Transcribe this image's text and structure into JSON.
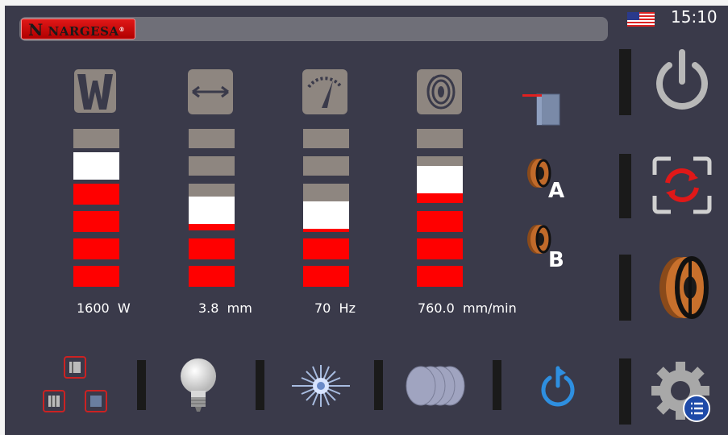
{
  "header": {
    "brand": "NARGESA",
    "brand_initial": "N",
    "registered": "®",
    "time": "15:10",
    "language_flag": "us-flag-icon"
  },
  "meters": [
    {
      "id": "power",
      "icon": "power-w-icon",
      "value_text": "1600  W",
      "level_segments": [
        "gray",
        "white",
        "red",
        "red",
        "red",
        "red"
      ]
    },
    {
      "id": "width",
      "icon": "width-arrows-icon",
      "value_text": "3.8  mm",
      "level_segments": [
        "gray",
        "gray",
        "gray",
        "white",
        "red",
        "red",
        "red"
      ]
    },
    {
      "id": "frequency",
      "icon": "gauge-icon",
      "value_text": "70  Hz",
      "level_segments": [
        "gray",
        "gray",
        "gray",
        "white",
        "red",
        "red",
        "red"
      ]
    },
    {
      "id": "wire_speed",
      "icon": "wire-spool-icon",
      "value_text": "760.0  mm/min",
      "level_segments": [
        "gray",
        "gray",
        "white",
        "red",
        "red",
        "red"
      ]
    }
  ],
  "wire_selector": {
    "spool_a_label": "A",
    "spool_b_label": "B"
  },
  "colors": {
    "background": "#3a3a4a",
    "segment_red": "#ff0000",
    "segment_white": "#ffffff",
    "segment_gray": "#8e8680",
    "accent_blue": "#2e8fe0"
  }
}
